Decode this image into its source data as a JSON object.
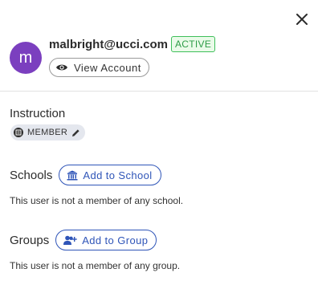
{
  "user": {
    "avatar_initial": "m",
    "email": "malbright@ucci.com",
    "status": "ACTIVE",
    "view_account_label": "View Account"
  },
  "instruction": {
    "title": "Instruction",
    "role": "MEMBER"
  },
  "schools": {
    "title": "Schools",
    "add_label": "Add to School",
    "empty_text": "This user is not a member of any school."
  },
  "groups": {
    "title": "Groups",
    "add_label": "Add to Group",
    "empty_text": "This user is not a member of any group."
  },
  "colors": {
    "avatar": "#7b3fbf",
    "accent": "#2f55b8",
    "active_green": "#2e9c47"
  },
  "icons": {
    "close": "close-icon",
    "view": "eye-icon",
    "role": "role-icon",
    "edit": "pencil-icon",
    "school": "school-building-icon",
    "group": "add-group-icon"
  }
}
